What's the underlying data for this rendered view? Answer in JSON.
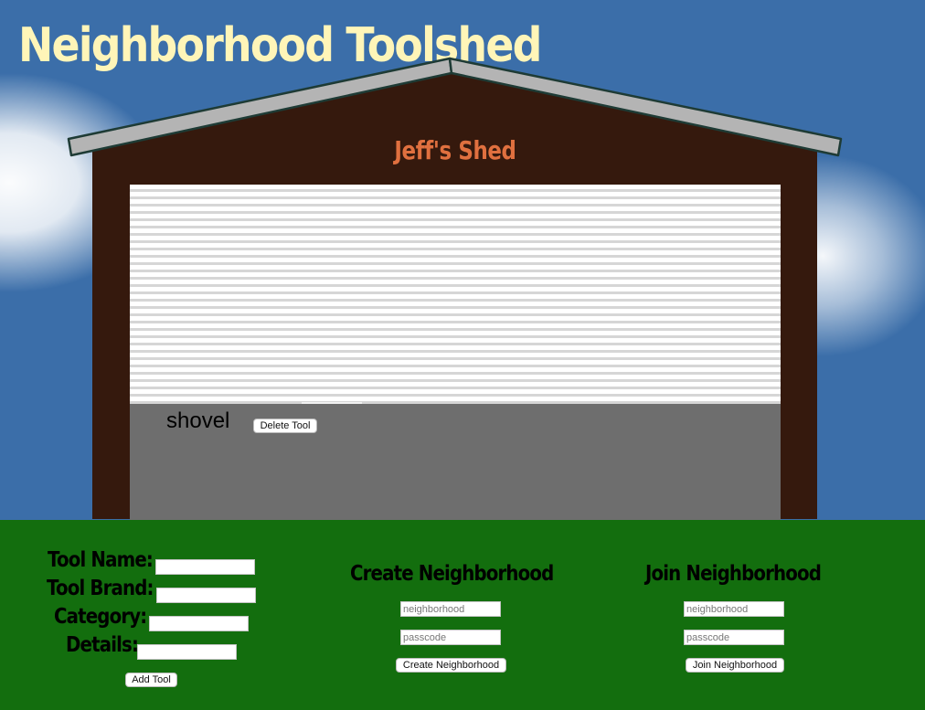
{
  "site": {
    "title": "Neighborhood Toolshed"
  },
  "shed": {
    "name": "Jeff's Shed",
    "tools": [
      {
        "name": "shovel",
        "delete_label": "Delete Tool"
      }
    ]
  },
  "add_tool_form": {
    "tool_name_label": "Tool Name:",
    "tool_brand_label": "Tool Brand:",
    "category_label": "Category:",
    "details_label": "Details:",
    "submit_label": "Add Tool"
  },
  "create_neighborhood": {
    "heading": "Create Neighborhood",
    "neighborhood_placeholder": "neighborhood",
    "passcode_placeholder": "passcode",
    "submit_label": "Create Neighborhood"
  },
  "join_neighborhood": {
    "heading": "Join Neighborhood",
    "neighborhood_placeholder": "neighborhood",
    "passcode_placeholder": "passcode",
    "submit_label": "Join Neighborhood"
  },
  "colors": {
    "sky": "#3b6ea9",
    "title": "#fff5b8",
    "shed_wall": "#35190d",
    "roof": "#b4b4b4",
    "shed_name": "#e0703f",
    "floor": "#6e6e6e",
    "grass": "#136e0e"
  }
}
